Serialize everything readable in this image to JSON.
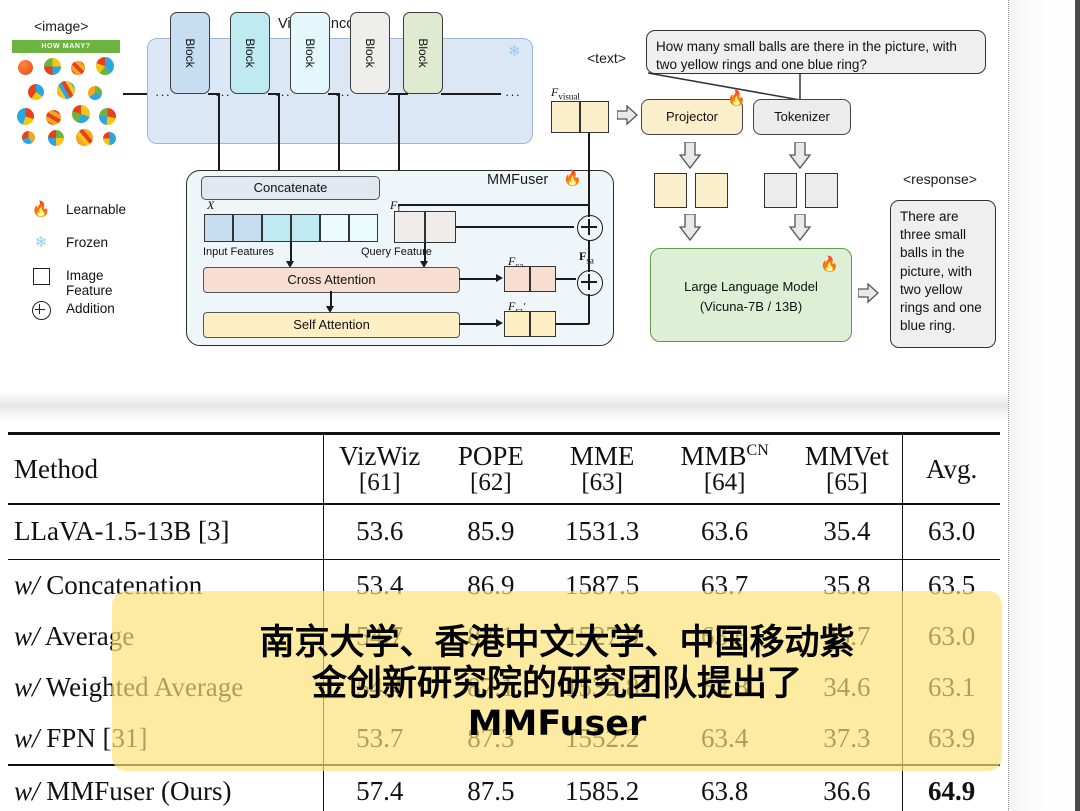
{
  "figure": {
    "image_label": "<image>",
    "text_label": "<text>",
    "response_label": "<response>",
    "vision_encoder_title": "Vision Encoder",
    "thumbnail_banner": "HOW MANY?",
    "block_label": "Block",
    "ellipsis": "···",
    "mmfuser_title": "MMFuser",
    "concatenate": "Concatenate",
    "cross_attention": "Cross Attention",
    "self_attention": "Self Attention",
    "input_features": "Input Features",
    "query_feature": "Query Feature",
    "label_x": "X",
    "label_fl": "F",
    "label_fl_sub": "L",
    "label_fca": "F",
    "label_fca_sub": "ca",
    "label_fsa_prime": "F",
    "label_fsa_prime_sub": "sa",
    "label_fsa_bold": "F",
    "label_fsa_bold_sub": "sa",
    "label_fvisual": "F",
    "label_fvisual_sub": "visual",
    "projector": "Projector",
    "tokenizer": "Tokenizer",
    "llm_line1": "Large Language Model",
    "llm_line2": "(Vicuna-7B / 13B)",
    "question": "How many small balls are there in the picture, with two yellow rings and one blue ring?",
    "answer": "There are three small balls in the picture, with two yellow rings and one blue ring.",
    "legend": [
      {
        "icon": "flame-icon",
        "label": "Learnable"
      },
      {
        "icon": "snowflake-icon",
        "label": "Frozen"
      },
      {
        "icon": "square-outline-icon",
        "label": "Image Feature"
      },
      {
        "icon": "circled-plus-icon",
        "label": "Addition"
      }
    ],
    "colors": {
      "encoder_panel": "#dce7f6",
      "mmfuser_panel": "#eef6f9",
      "cross_attention": "#f7ded0",
      "self_attention": "#fdeec4",
      "projector": "#fbeeca",
      "llm": "#ddf0d6",
      "visual_feature": "#fbeeca",
      "banner_green": "#6cb33f"
    }
  },
  "table": {
    "columns": [
      {
        "name": "Method",
        "ref": ""
      },
      {
        "name": "VizWiz",
        "ref": "[61]"
      },
      {
        "name": "POPE",
        "ref": "[62]"
      },
      {
        "name": "MME",
        "ref": "[63]"
      },
      {
        "name": "MMB",
        "sup": "CN",
        "ref": "[64]"
      },
      {
        "name": "MMVet",
        "ref": "[65]"
      },
      {
        "name": "Avg.",
        "ref": ""
      }
    ],
    "rows": [
      {
        "prefix": "",
        "method": "LLaVA-1.5-13B [3]",
        "values": [
          "53.6",
          "85.9",
          "1531.3",
          "63.6",
          "35.4",
          "63.0"
        ],
        "bold_avg": false
      },
      {
        "prefix": "w/",
        "method": "Concatenation",
        "values": [
          "53.4",
          "86.9",
          "1587.5",
          "63.7",
          "35.8",
          "63.5"
        ],
        "bold_avg": false
      },
      {
        "prefix": "w/",
        "method": "Average",
        "values": [
          "54.7",
          "87.1",
          "1527.9",
          "63.6",
          "35.7",
          "63.0"
        ],
        "bold_avg": false
      },
      {
        "prefix": "w/",
        "method": "Weighted Average",
        "values": [
          "54.4",
          "87.1",
          "1532.8",
          "63.8",
          "34.6",
          "63.1"
        ],
        "bold_avg": false
      },
      {
        "prefix": "w/",
        "method": "FPN [31]",
        "values": [
          "53.7",
          "87.3",
          "1552.2",
          "63.4",
          "37.3",
          "63.9"
        ],
        "bold_avg": false
      },
      {
        "prefix": "w/",
        "method": "MMFuser (Ours)",
        "values": [
          "57.4",
          "87.5",
          "1585.2",
          "63.8",
          "36.6",
          "64.9"
        ],
        "bold_avg": true
      }
    ]
  },
  "overlay": {
    "line1": "南京大学、香港中文大学、中国移动紫",
    "line2": "金创新研究院的研究团队提出了",
    "line3": "MMFuser",
    "background_color": "#fce274"
  }
}
